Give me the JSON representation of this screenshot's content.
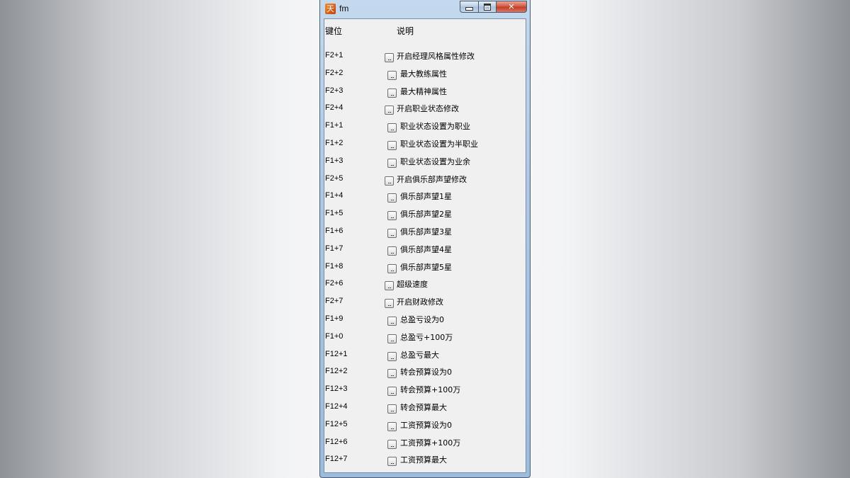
{
  "window": {
    "title": "fm",
    "app_icon_glyph": "hack-tool-icon",
    "controls": {
      "minimize": "minimize-icon",
      "maximize": "maximize-icon",
      "close_label": "✕"
    }
  },
  "header": {
    "key_col": "键位",
    "desc_col": "说明"
  },
  "button_label": "...",
  "rows": [
    {
      "key": "F2+1",
      "label": "开启经理风格属性修改",
      "level": 0
    },
    {
      "key": "F2+2",
      "label": "最大教练属性",
      "level": 1
    },
    {
      "key": "F2+3",
      "label": "最大精神属性",
      "level": 1
    },
    {
      "key": "F2+4",
      "label": "开启职业状态修改",
      "level": 0
    },
    {
      "key": "F1+1",
      "label": "职业状态设置为职业",
      "level": 1
    },
    {
      "key": "F1+2",
      "label": "职业状态设置为半职业",
      "level": 1
    },
    {
      "key": "F1+3",
      "label": "职业状态设置为业余",
      "level": 1
    },
    {
      "key": "F2+5",
      "label": "开启俱乐部声望修改",
      "level": 0
    },
    {
      "key": "F1+4",
      "label": "俱乐部声望1星",
      "level": 1
    },
    {
      "key": "F1+5",
      "label": "俱乐部声望2星",
      "level": 1
    },
    {
      "key": "F1+6",
      "label": "俱乐部声望3星",
      "level": 1
    },
    {
      "key": "F1+7",
      "label": "俱乐部声望4星",
      "level": 1
    },
    {
      "key": "F1+8",
      "label": "俱乐部声望5星",
      "level": 1
    },
    {
      "key": "F2+6",
      "label": "超级速度",
      "level": 0
    },
    {
      "key": "F2+7",
      "label": "开启财政修改",
      "level": 0
    },
    {
      "key": "F1+9",
      "label": "总盈亏设为0",
      "level": 1
    },
    {
      "key": "F1+0",
      "label": "总盈亏+100万",
      "level": 1
    },
    {
      "key": "F12+1",
      "label": "总盈亏最大",
      "level": 1
    },
    {
      "key": "F12+2",
      "label": "转会预算设为0",
      "level": 1
    },
    {
      "key": "F12+3",
      "label": "转会预算+100万",
      "level": 1
    },
    {
      "key": "F12+4",
      "label": "转会预算最大",
      "level": 1
    },
    {
      "key": "F12+5",
      "label": "工资预算设为0",
      "level": 1
    },
    {
      "key": "F12+6",
      "label": "工资预算+100万",
      "level": 1
    },
    {
      "key": "F12+7",
      "label": "工资预算最大",
      "level": 1
    }
  ]
}
